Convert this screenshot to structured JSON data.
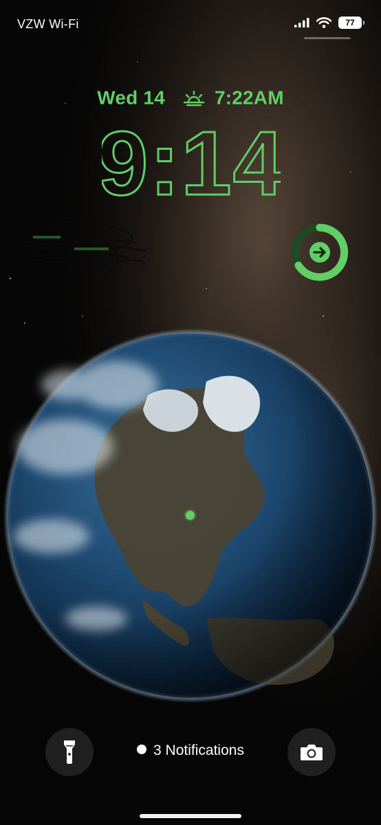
{
  "status_bar": {
    "carrier": "VZW Wi-Fi",
    "battery_level": "77",
    "icons": [
      "cellular-signal-icon",
      "wifi-icon",
      "battery-icon"
    ]
  },
  "lock_screen": {
    "date": "Wed 14",
    "sunrise_time": "7:22AM",
    "time": "9:14",
    "notifications_label": "3 Notifications",
    "accent_color": "#5fcf66"
  },
  "widgets": {
    "fitness_ring_icon": "arrow-right-icon"
  },
  "controls": {
    "left_icon": "flashlight-icon",
    "right_icon": "camera-icon"
  }
}
